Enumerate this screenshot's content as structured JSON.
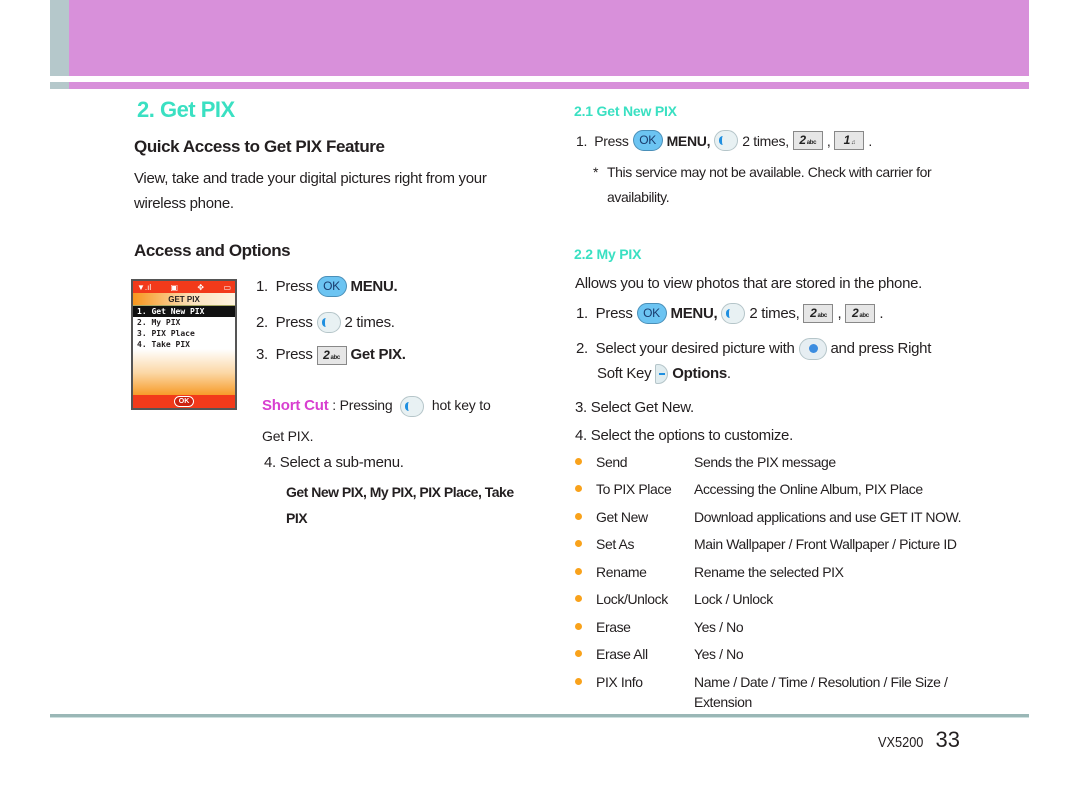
{
  "colors": {
    "header_band": "#d890da",
    "accent_teal": "#3ae0c2",
    "shortcut_magenta": "#d83fd0",
    "bullet_orange": "#f9a21b"
  },
  "section_title": "2. Get PIX",
  "left": {
    "quick_access_heading": "Quick Access to Get PIX  Feature",
    "intro_line1": "View, take and trade your digital pictures right from your",
    "intro_line2": "wireless phone.",
    "access_heading": "Access and Options",
    "phone_screen": {
      "status_icons": [
        "signal-icon",
        "message-icon",
        "navigation-icon",
        "battery-icon"
      ],
      "title": "GET PIX",
      "items": [
        "1. Get New PIX",
        "2. My PIX",
        "3. PIX Place",
        "4. Take PIX"
      ],
      "selected_index": 0,
      "soft_key": "OK"
    },
    "steps": [
      {
        "num": "1.",
        "pre": "Press",
        "key": "OK",
        "post": "MENU."
      },
      {
        "num": "2.",
        "pre": "Press",
        "post": "2 times."
      },
      {
        "num": "3.",
        "pre": "Press",
        "key_num": "2",
        "key_sub": "abc",
        "post": "Get PIX."
      }
    ],
    "shortcut_label": "Short Cut",
    "shortcut_text_a": " : Pressing ",
    "shortcut_text_b": " hot key to",
    "shortcut_text_c": "Get PIX.",
    "step4": "4.  Select a sub-menu.",
    "submenu_line1": "Get New PIX, My PIX, PIX Place, Take",
    "submenu_line2": "PIX"
  },
  "right": {
    "s21_heading": "2.1 Get New PIX",
    "s21_step": {
      "num": "1.",
      "pre": "Press",
      "key": "OK",
      "menu": "MENU,",
      "times": "2 times,",
      "key1_num": "2",
      "key1_sub": "abc",
      "key2_num": "1",
      "key2_sub": "",
      "end": "."
    },
    "s21_note_star": "*",
    "s21_note": "This service may not be available. Check with carrier for availability.",
    "s22_heading": "2.2 My PIX",
    "s22_intro": "Allows you to view photos that are stored in the phone.",
    "s22_step1": {
      "num": "1.",
      "pre": "Press",
      "key": "OK",
      "menu": "MENU,",
      "times": "2 times,",
      "key1_num": "2",
      "key1_sub": "abc",
      "key2_num": "2",
      "key2_sub": "abc",
      "end": "."
    },
    "s22_step2": {
      "num": "2.",
      "line1_pre": "Select your desired picture with",
      "line1_post": "and press Right",
      "line2_pre": "Soft Key",
      "line2_post": "Options",
      "end": "."
    },
    "s22_step3": "3.  Select Get New.",
    "s22_step4": "4.  Select the options to customize.",
    "options": [
      {
        "name": "Send",
        "desc": "Sends the PIX message"
      },
      {
        "name": "To PIX Place",
        "desc": "Accessing the Online Album, PIX Place"
      },
      {
        "name": "Get New",
        "desc": "Download applications and use GET IT NOW."
      },
      {
        "name": "Set As",
        "desc": "Main Wallpaper / Front Wallpaper / Picture ID"
      },
      {
        "name": "Rename",
        "desc": "Rename the selected PIX"
      },
      {
        "name": "Lock/Unlock",
        "desc": "Lock / Unlock"
      },
      {
        "name": "Erase",
        "desc": "Yes / No"
      },
      {
        "name": "Erase All",
        "desc": "Yes / No"
      },
      {
        "name": "PIX Info",
        "desc": "Name / Date / Time / Resolution / File Size / Extension"
      }
    ]
  },
  "footer": {
    "model": "VX5200",
    "page": "33"
  }
}
